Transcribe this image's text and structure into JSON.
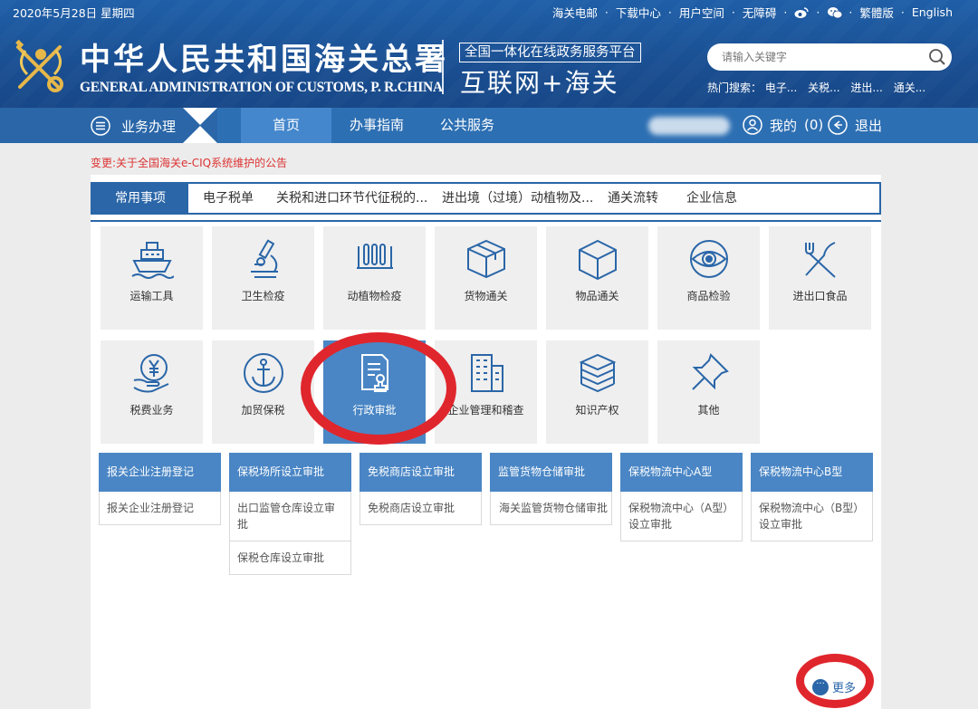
{
  "header": {
    "date": "2020年5月28日  星期四",
    "top_links": [
      "海关电邮",
      "下载中心",
      "用户空间",
      "无障碍"
    ],
    "lang_trad": "繁體版",
    "lang_en": "English",
    "cn_title": "中华人民共和国海关总署",
    "en_title": "GENERAL ADMINISTRATION OF CUSTOMS, P. R.CHINA",
    "platform": "全国一体化在线政务服务平台",
    "slogan": "互联网+海关",
    "search_placeholder": "请输入关键字",
    "hot_label": "热门搜索：",
    "hot_terms": [
      "电子...",
      "关税...",
      "进出...",
      "通关..."
    ]
  },
  "nav": {
    "menu": "业务办理",
    "tabs": [
      "首页",
      "办事指南",
      "公共服务"
    ],
    "mine": "我的",
    "mine_count": "(0)",
    "logout": "退出"
  },
  "notice": "变更:关于全国海关e-CIQ系统维护的公告",
  "tabs": [
    "常用事项",
    "电子税单",
    "关税和进口环节代征税的...",
    "进出境（过境）动植物及...",
    "通关流转",
    "企业信息"
  ],
  "tiles_row1": [
    {
      "label": "运输工具",
      "icon": "ship-icon"
    },
    {
      "label": "卫生检疫",
      "icon": "microscope-icon"
    },
    {
      "label": "动植物检疫",
      "icon": "test-tubes-icon"
    },
    {
      "label": "货物通关",
      "icon": "cargo-box-icon"
    },
    {
      "label": "物品通关",
      "icon": "cube-icon"
    },
    {
      "label": "商品检验",
      "icon": "eye-icon"
    },
    {
      "label": "进出口食品",
      "icon": "fork-knife-icon"
    }
  ],
  "tiles_row2": [
    {
      "label": "税费业务",
      "icon": "yuan-hand-icon"
    },
    {
      "label": "加贸保税",
      "icon": "anchor-icon"
    },
    {
      "label": "行政审批",
      "icon": "document-stamp-icon"
    },
    {
      "label": "企业管理和稽查",
      "icon": "building-icon"
    },
    {
      "label": "知识产权",
      "icon": "books-icon"
    },
    {
      "label": "其他",
      "icon": "pin-icon"
    }
  ],
  "subcards": [
    {
      "title": "报关企业注册登记",
      "items": [
        "报关企业注册登记"
      ]
    },
    {
      "title": "保税场所设立审批",
      "items": [
        "出口监管仓库设立审批",
        "保税仓库设立审批"
      ]
    },
    {
      "title": "免税商店设立审批",
      "items": [
        "免税商店设立审批"
      ]
    },
    {
      "title": "监管货物仓储审批",
      "items": [
        "海关监管货物仓储审批"
      ]
    },
    {
      "title": "保税物流中心A型",
      "items": [
        "保税物流中心（A型）设立审批"
      ]
    },
    {
      "title": "保税物流中心B型",
      "items": [
        "保税物流中心（B型）设立审批"
      ]
    }
  ],
  "more": "更多",
  "colors": {
    "primary": "#2a66a8",
    "tile_selected": "#4a86c5",
    "annotation_red": "#e0262d",
    "notice_red": "#dd3333"
  }
}
